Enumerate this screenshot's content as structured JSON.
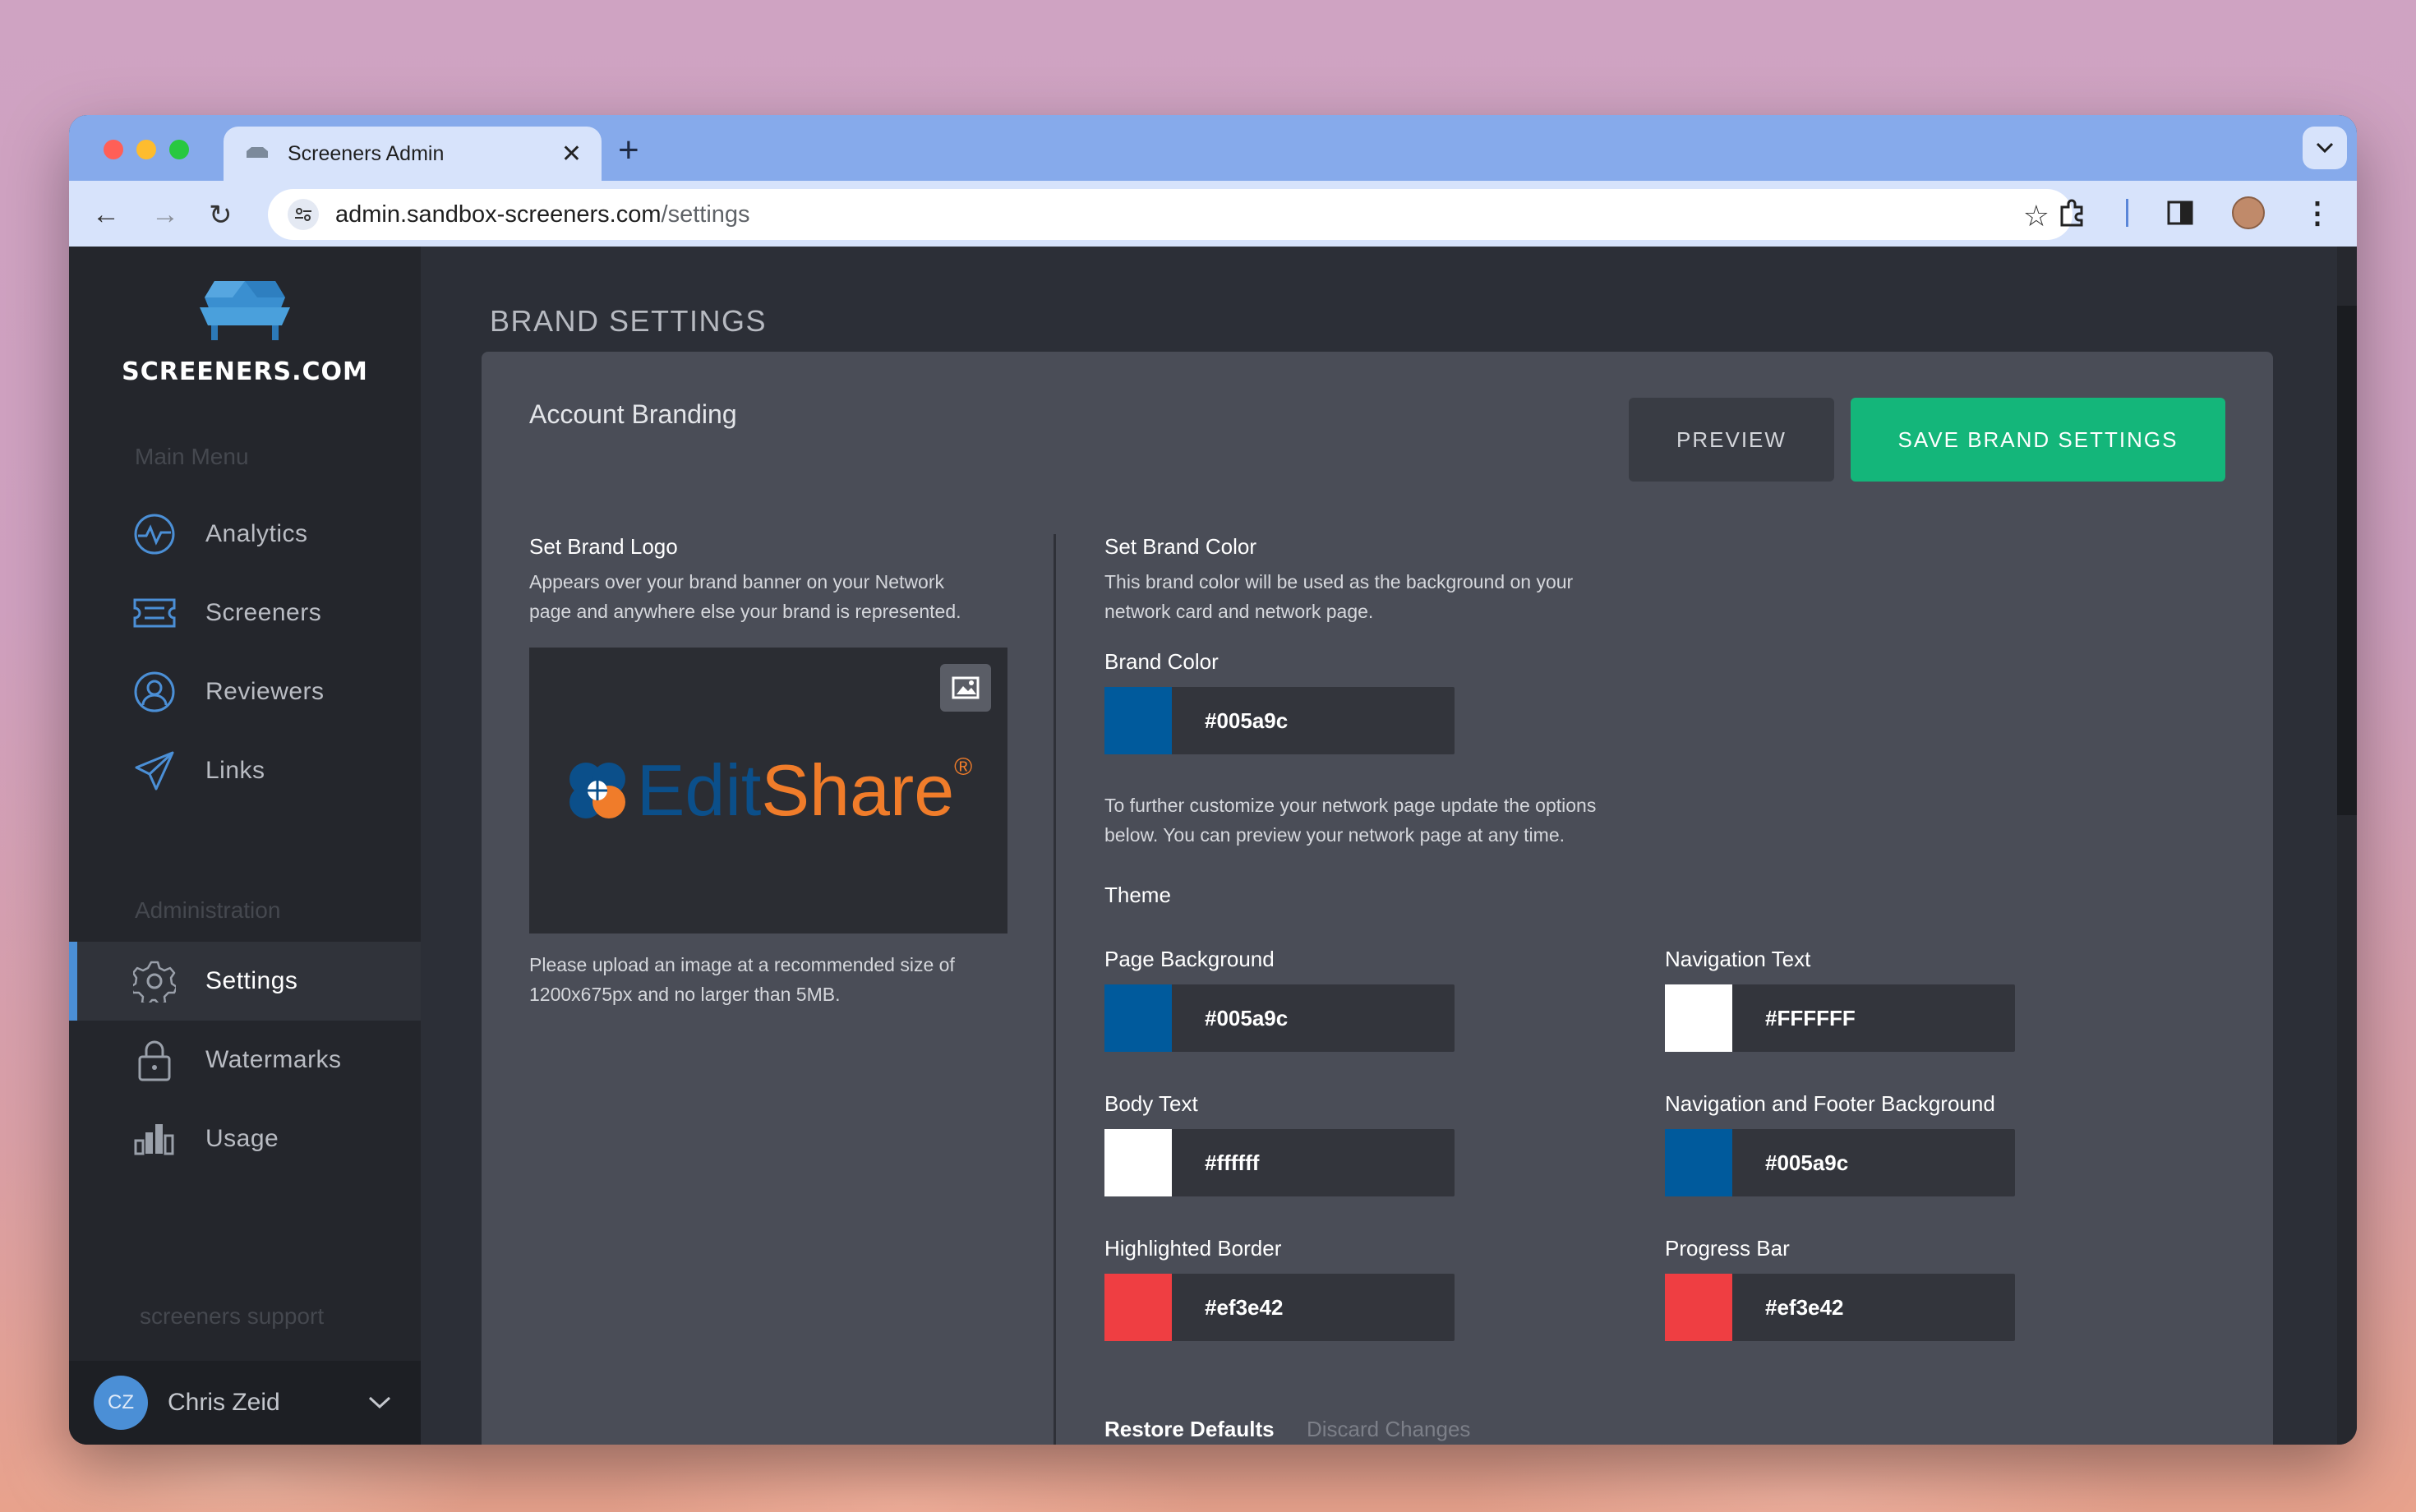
{
  "browser": {
    "tab_title": "Screeners Admin",
    "url_host": "admin.sandbox-screeners.com",
    "url_path": "/settings"
  },
  "sidebar": {
    "brand": "SCREENERS.COM",
    "main_menu_label": "Main Menu",
    "main_items": [
      {
        "label": "Analytics",
        "icon": "pulse-icon"
      },
      {
        "label": "Screeners",
        "icon": "ticket-icon"
      },
      {
        "label": "Reviewers",
        "icon": "user-circle-icon"
      },
      {
        "label": "Links",
        "icon": "paper-plane-icon"
      }
    ],
    "admin_label": "Administration",
    "admin_items": [
      {
        "label": "Settings",
        "icon": "gear-icon",
        "active": true
      },
      {
        "label": "Watermarks",
        "icon": "lock-icon"
      },
      {
        "label": "Usage",
        "icon": "bar-chart-icon"
      }
    ],
    "support_label": "screeners support",
    "user": {
      "initials": "CZ",
      "name": "Chris Zeid"
    }
  },
  "page": {
    "title": "BRAND SETTINGS",
    "card_title": "Account Branding",
    "preview_label": "PREVIEW",
    "save_label": "SAVE BRAND SETTINGS"
  },
  "logo_section": {
    "heading": "Set Brand Logo",
    "desc_line1": "Appears over your brand banner on your Network",
    "desc_line2": "page and anywhere else your brand is represented.",
    "logo_word1": "Edit",
    "logo_word2": "Share",
    "logo_reg": "®",
    "note_line1": "Please upload an image at a recommended size of",
    "note_line2": "1200x675px and no larger than 5MB."
  },
  "color_section": {
    "heading": "Set Brand Color",
    "desc_line1": "This brand color will be used as the background on your",
    "desc_line2": "network card and network page.",
    "brand_color_label": "Brand Color",
    "brand_color_value": "#005a9c",
    "further_line1": "To further customize your network page update the options",
    "further_line2": "below. You can preview your network page at any time.",
    "theme_label": "Theme",
    "fields": {
      "page_background": {
        "label": "Page Background",
        "value": "#005a9c",
        "swatch": "#005a9c"
      },
      "navigation_text": {
        "label": "Navigation Text",
        "value": "#FFFFFF",
        "swatch": "#ffffff"
      },
      "body_text": {
        "label": "Body Text",
        "value": "#ffffff",
        "swatch": "#ffffff"
      },
      "nav_footer_bg": {
        "label": "Navigation and Footer Background",
        "value": "#005a9c",
        "swatch": "#005a9c"
      },
      "highlighted_border": {
        "label": "Highlighted Border",
        "value": "#ef3e42",
        "swatch": "#ef3e42"
      },
      "progress_bar": {
        "label": "Progress Bar",
        "value": "#ef3e42",
        "swatch": "#ef3e42"
      }
    },
    "restore_label": "Restore Defaults",
    "discard_label": "Discard Changes"
  },
  "colors": {
    "accent_green": "#14b67a",
    "accent_blue": "#4b8fd6"
  }
}
